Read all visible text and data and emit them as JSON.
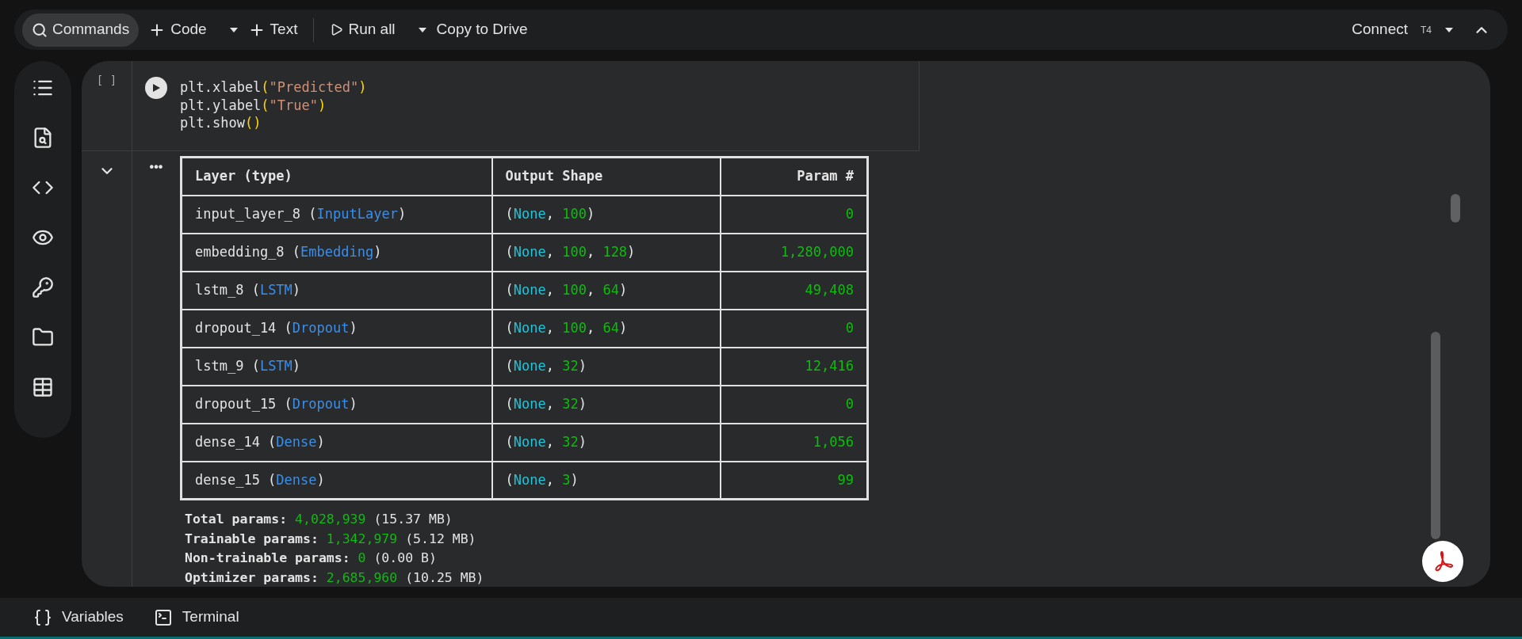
{
  "toolbar": {
    "left": [
      {
        "kind": "search",
        "label": "Commands",
        "selected": true,
        "dropdown": false
      },
      {
        "kind": "add",
        "label": "Code",
        "dropdown": true
      },
      {
        "kind": "add",
        "label": "Text",
        "dropdown": false
      },
      {
        "kind": "run",
        "label": "Run all",
        "dropdown": true
      },
      {
        "kind": "plain",
        "label": "Copy to Drive",
        "dropdown": false
      }
    ],
    "connect": {
      "label": "Connect",
      "runtime": "T4"
    }
  },
  "sidebar": {
    "items": [
      {
        "kind": "toc"
      },
      {
        "kind": "find"
      },
      {
        "kind": "snippets"
      },
      {
        "kind": "secrets-eye"
      },
      {
        "kind": "key"
      },
      {
        "kind": "files"
      },
      {
        "kind": "table"
      }
    ]
  },
  "cell": {
    "execution_count": "[ ]",
    "code_lines": [
      [
        {
          "text": "plt.xlabel",
          "kind": "plain"
        },
        {
          "text": "(",
          "kind": "paren"
        },
        {
          "text": "\"Predicted\"",
          "kind": "string"
        },
        {
          "text": ")",
          "kind": "paren"
        }
      ],
      [
        {
          "text": "plt.ylabel",
          "kind": "plain"
        },
        {
          "text": "(",
          "kind": "paren"
        },
        {
          "text": "\"True\"",
          "kind": "string"
        },
        {
          "text": ")",
          "kind": "paren"
        }
      ],
      [
        {
          "text": "plt.show",
          "kind": "plain"
        },
        {
          "text": "()",
          "kind": "paren"
        }
      ]
    ],
    "output_menu": "•••",
    "table": {
      "columns": [
        "Layer (type)",
        "Output Shape",
        "Param #"
      ],
      "rows": [
        {
          "layer": [
            {
              "text": "input_layer_8 (",
              "kind": "plain"
            },
            {
              "text": "InputLayer",
              "kind": "type"
            },
            {
              "text": ")",
              "kind": "plain"
            }
          ],
          "shape": [
            {
              "text": "(",
              "kind": "plain"
            },
            {
              "text": "None",
              "kind": "none"
            },
            {
              "text": ", ",
              "kind": "plain"
            },
            {
              "text": "100",
              "kind": "num"
            },
            {
              "text": ")",
              "kind": "plain"
            }
          ],
          "params": "0"
        },
        {
          "layer": [
            {
              "text": "embedding_8 (",
              "kind": "plain"
            },
            {
              "text": "Embedding",
              "kind": "type"
            },
            {
              "text": ")",
              "kind": "plain"
            }
          ],
          "shape": [
            {
              "text": "(",
              "kind": "plain"
            },
            {
              "text": "None",
              "kind": "none"
            },
            {
              "text": ", ",
              "kind": "plain"
            },
            {
              "text": "100",
              "kind": "num"
            },
            {
              "text": ", ",
              "kind": "plain"
            },
            {
              "text": "128",
              "kind": "num"
            },
            {
              "text": ")",
              "kind": "plain"
            }
          ],
          "params": "1,280,000"
        },
        {
          "layer": [
            {
              "text": "lstm_8 (",
              "kind": "plain"
            },
            {
              "text": "LSTM",
              "kind": "type"
            },
            {
              "text": ")",
              "kind": "plain"
            }
          ],
          "shape": [
            {
              "text": "(",
              "kind": "plain"
            },
            {
              "text": "None",
              "kind": "none"
            },
            {
              "text": ", ",
              "kind": "plain"
            },
            {
              "text": "100",
              "kind": "num"
            },
            {
              "text": ", ",
              "kind": "plain"
            },
            {
              "text": "64",
              "kind": "num"
            },
            {
              "text": ")",
              "kind": "plain"
            }
          ],
          "params": "49,408"
        },
        {
          "layer": [
            {
              "text": "dropout_14 (",
              "kind": "plain"
            },
            {
              "text": "Dropout",
              "kind": "type"
            },
            {
              "text": ")",
              "kind": "plain"
            }
          ],
          "shape": [
            {
              "text": "(",
              "kind": "plain"
            },
            {
              "text": "None",
              "kind": "none"
            },
            {
              "text": ", ",
              "kind": "plain"
            },
            {
              "text": "100",
              "kind": "num"
            },
            {
              "text": ", ",
              "kind": "plain"
            },
            {
              "text": "64",
              "kind": "num"
            },
            {
              "text": ")",
              "kind": "plain"
            }
          ],
          "params": "0"
        },
        {
          "layer": [
            {
              "text": "lstm_9 (",
              "kind": "plain"
            },
            {
              "text": "LSTM",
              "kind": "type"
            },
            {
              "text": ")",
              "kind": "plain"
            }
          ],
          "shape": [
            {
              "text": "(",
              "kind": "plain"
            },
            {
              "text": "None",
              "kind": "none"
            },
            {
              "text": ", ",
              "kind": "plain"
            },
            {
              "text": "32",
              "kind": "num"
            },
            {
              "text": ")",
              "kind": "plain"
            }
          ],
          "params": "12,416"
        },
        {
          "layer": [
            {
              "text": "dropout_15 (",
              "kind": "plain"
            },
            {
              "text": "Dropout",
              "kind": "type"
            },
            {
              "text": ")",
              "kind": "plain"
            }
          ],
          "shape": [
            {
              "text": "(",
              "kind": "plain"
            },
            {
              "text": "None",
              "kind": "none"
            },
            {
              "text": ", ",
              "kind": "plain"
            },
            {
              "text": "32",
              "kind": "num"
            },
            {
              "text": ")",
              "kind": "plain"
            }
          ],
          "params": "0"
        },
        {
          "layer": [
            {
              "text": "dense_14 (",
              "kind": "plain"
            },
            {
              "text": "Dense",
              "kind": "type"
            },
            {
              "text": ")",
              "kind": "plain"
            }
          ],
          "shape": [
            {
              "text": "(",
              "kind": "plain"
            },
            {
              "text": "None",
              "kind": "none"
            },
            {
              "text": ", ",
              "kind": "plain"
            },
            {
              "text": "32",
              "kind": "num"
            },
            {
              "text": ")",
              "kind": "plain"
            }
          ],
          "params": "1,056"
        },
        {
          "layer": [
            {
              "text": "dense_15 (",
              "kind": "plain"
            },
            {
              "text": "Dense",
              "kind": "type"
            },
            {
              "text": ")",
              "kind": "plain"
            }
          ],
          "shape": [
            {
              "text": "(",
              "kind": "plain"
            },
            {
              "text": "None",
              "kind": "none"
            },
            {
              "text": ", ",
              "kind": "plain"
            },
            {
              "text": "3",
              "kind": "num"
            },
            {
              "text": ")",
              "kind": "plain"
            }
          ],
          "params": "99"
        }
      ]
    },
    "summary": [
      [
        {
          "text": "Total params: ",
          "kind": "label"
        },
        {
          "text": "4,028,939",
          "kind": "num"
        },
        {
          "text": " (15.37 MB)",
          "kind": "plain"
        }
      ],
      [
        {
          "text": "Trainable params: ",
          "kind": "label"
        },
        {
          "text": "1,342,979",
          "kind": "num"
        },
        {
          "text": " (5.12 MB)",
          "kind": "plain"
        }
      ],
      [
        {
          "text": "Non-trainable params: ",
          "kind": "label"
        },
        {
          "text": "0",
          "kind": "num"
        },
        {
          "text": " (0.00 B)",
          "kind": "plain"
        }
      ],
      [
        {
          "text": "Optimizer params: ",
          "kind": "label"
        },
        {
          "text": "2,685,960",
          "kind": "num"
        },
        {
          "text": " (10.25 MB)",
          "kind": "plain"
        }
      ]
    ]
  },
  "bottom_bar": [
    {
      "kind": "variables",
      "label": "Variables"
    },
    {
      "kind": "terminal",
      "label": "Terminal"
    }
  ]
}
